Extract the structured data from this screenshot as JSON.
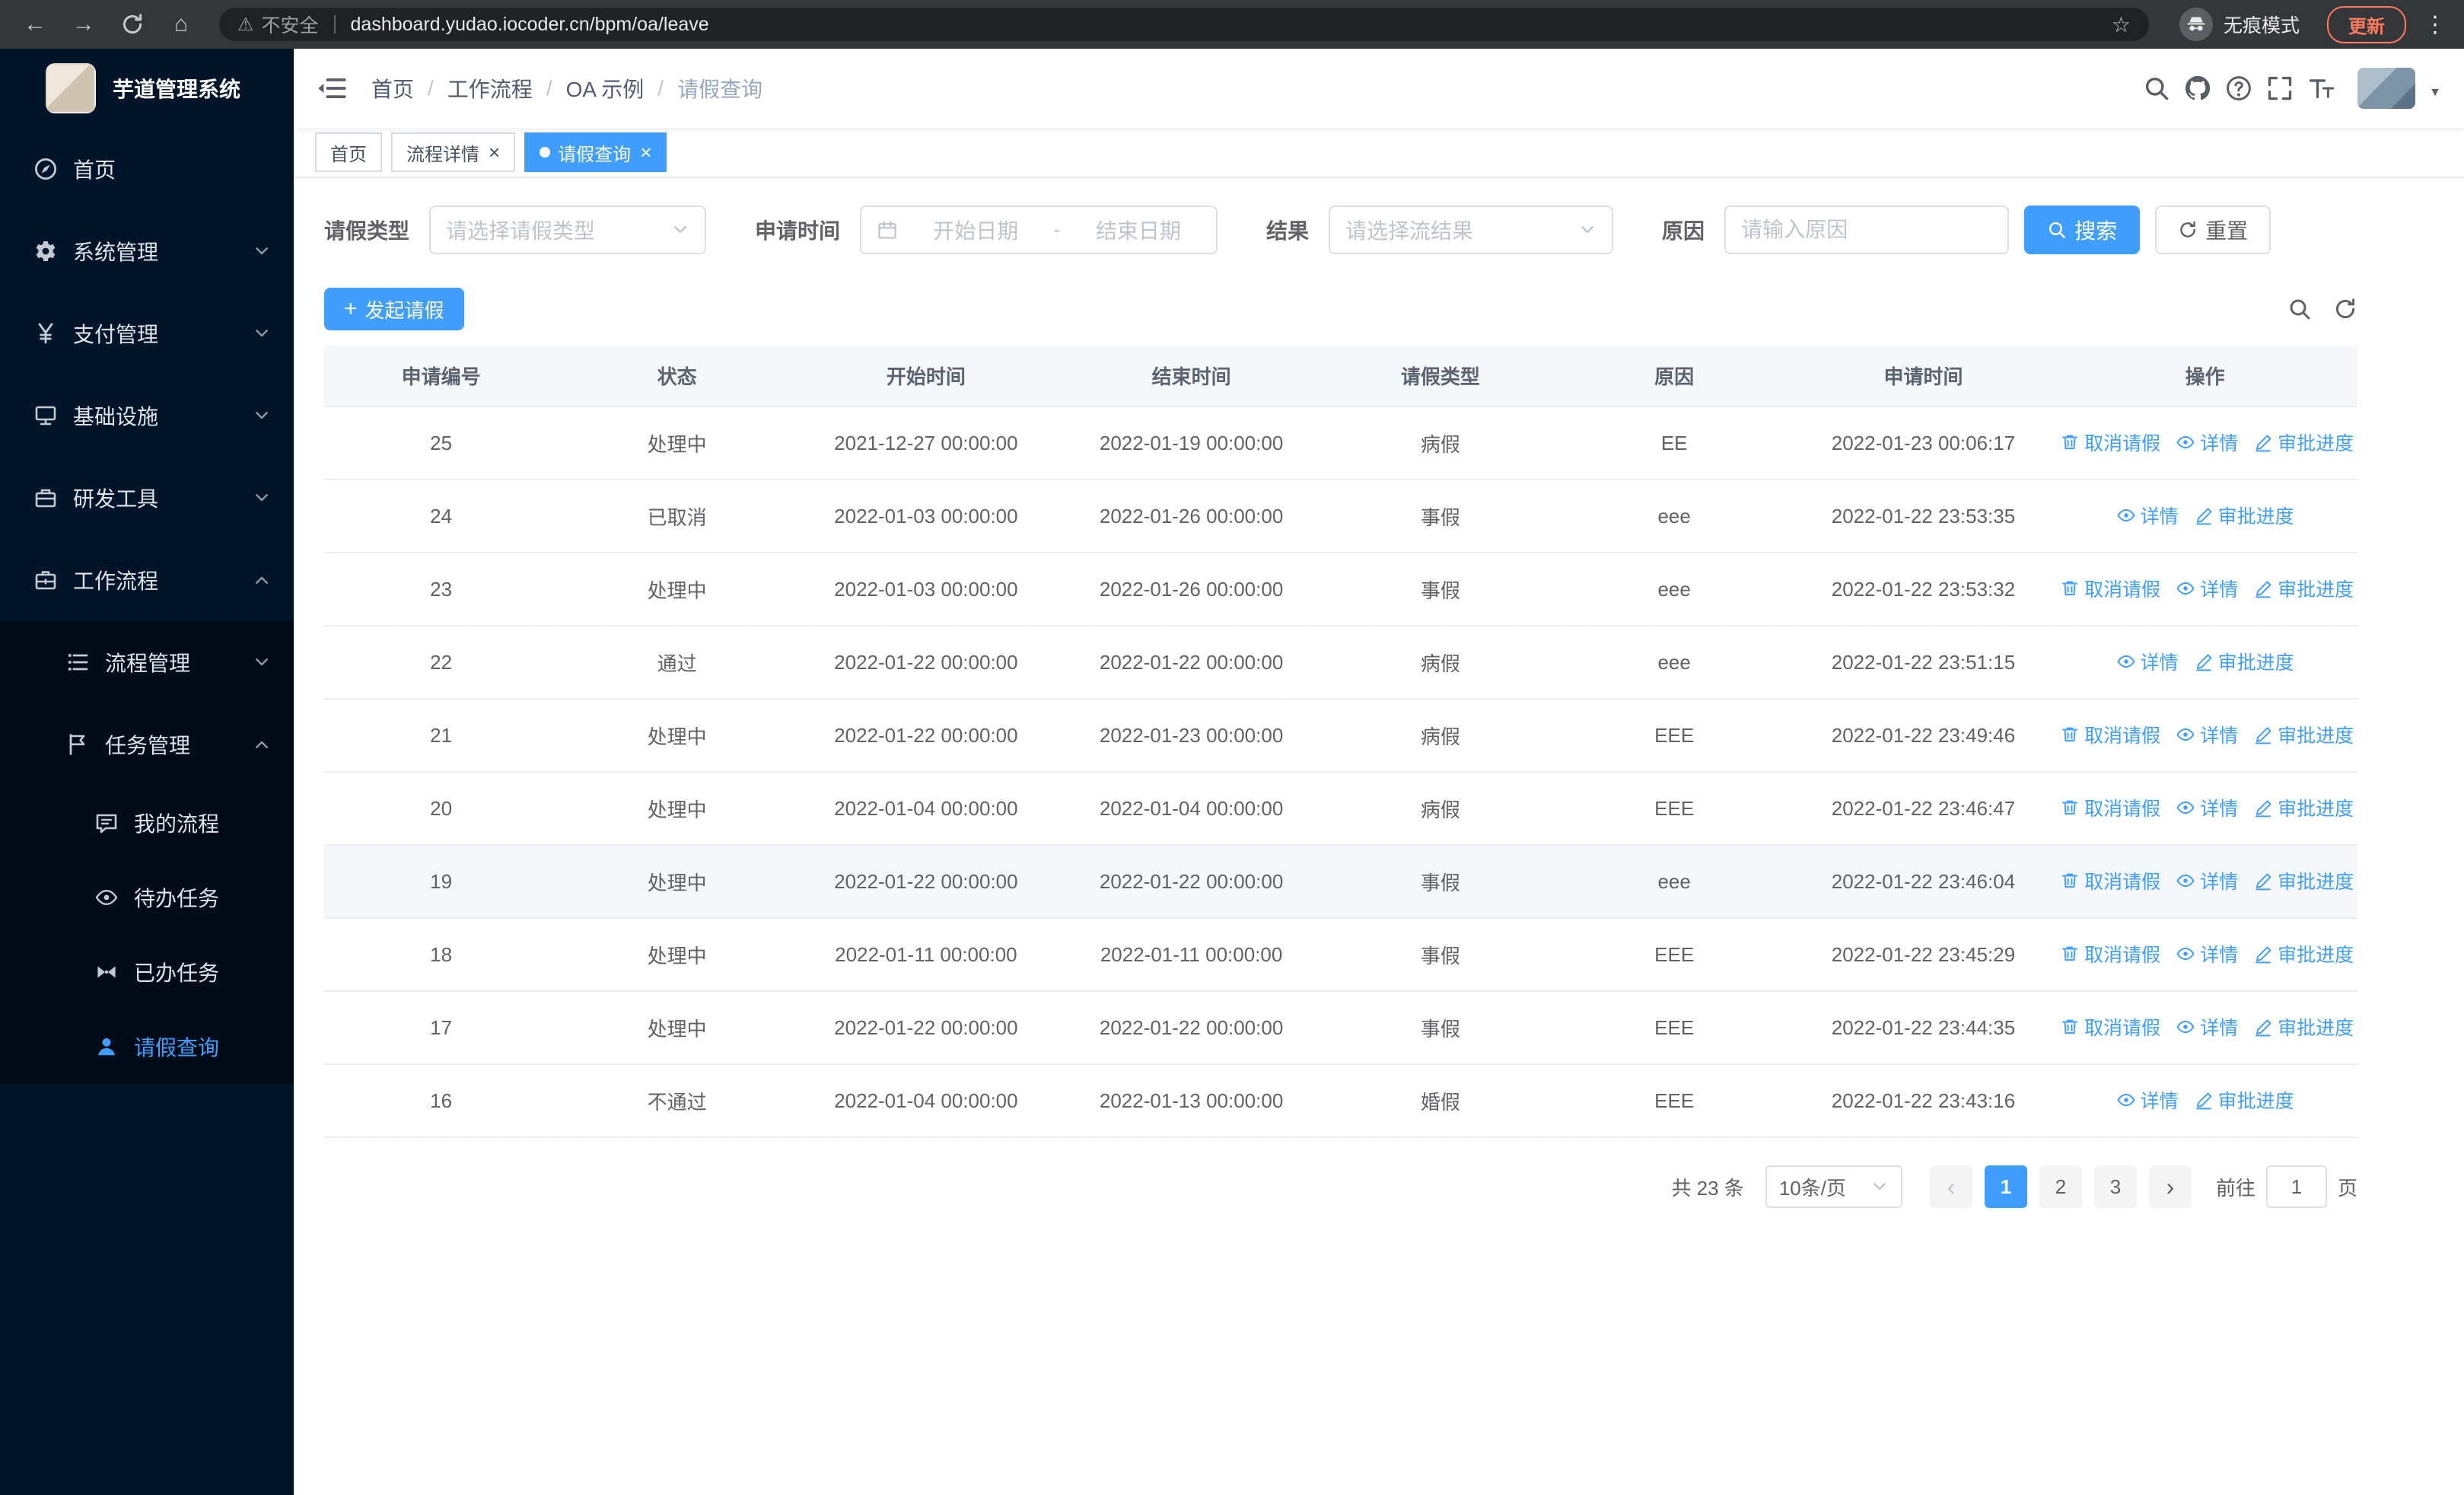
{
  "colors": {
    "primary": "#409eff",
    "link": "#409eff",
    "sidebar_bg": "#001529",
    "sidebar_sub_bg": "#000c17",
    "update_chip": "#ff7b5c"
  },
  "browser": {
    "security_warning": "不安全",
    "url": "dashboard.yudao.iocoder.cn/bpm/oa/leave",
    "incognito_label": "无痕模式",
    "update_button": "更新"
  },
  "sidebar": {
    "logo_title": "芋道管理系统",
    "menu": [
      {
        "id": "home",
        "label": "首页",
        "icon": "dashboard-icon",
        "level": 1
      },
      {
        "id": "system",
        "label": "系统管理",
        "icon": "gear-icon",
        "level": 1,
        "expandable": true
      },
      {
        "id": "payment",
        "label": "支付管理",
        "icon": "yen-icon",
        "level": 1,
        "expandable": true
      },
      {
        "id": "infrastructure",
        "label": "基础设施",
        "icon": "infrastructure-icon",
        "level": 1,
        "expandable": true
      },
      {
        "id": "devtools",
        "label": "研发工具",
        "icon": "toolbox-icon",
        "level": 1,
        "expandable": true
      },
      {
        "id": "workflow",
        "label": "工作流程",
        "icon": "briefcase-icon",
        "level": 1,
        "expandable": true,
        "expanded": true
      },
      {
        "id": "process-mgmt",
        "label": "流程管理",
        "icon": "list-icon",
        "level": 2,
        "expandable": true
      },
      {
        "id": "task-mgmt",
        "label": "任务管理",
        "icon": "flag-icon",
        "level": 2,
        "expandable": true,
        "expanded": true
      },
      {
        "id": "my-process",
        "label": "我的流程",
        "icon": "chat-icon",
        "level": 3
      },
      {
        "id": "todo-tasks",
        "label": "待办任务",
        "icon": "eye-icon",
        "level": 3
      },
      {
        "id": "done-tasks",
        "label": "已办任务",
        "icon": "scissors-icon",
        "level": 3
      },
      {
        "id": "leave-query",
        "label": "请假查询",
        "icon": "user-icon",
        "level": 3,
        "active": true
      }
    ]
  },
  "header": {
    "breadcrumb": [
      "首页",
      "工作流程",
      "OA 示例",
      "请假查询"
    ]
  },
  "tabs": [
    {
      "id": "home",
      "label": "首页",
      "closable": false,
      "active": false
    },
    {
      "id": "process-detail",
      "label": "流程详情",
      "closable": true,
      "active": false
    },
    {
      "id": "leave-query",
      "label": "请假查询",
      "closable": true,
      "active": true
    }
  ],
  "filters": {
    "leave_type_label": "请假类型",
    "leave_type_placeholder": "请选择请假类型",
    "apply_time_label": "申请时间",
    "start_date_placeholder": "开始日期",
    "date_separator": "-",
    "end_date_placeholder": "结束日期",
    "result_label": "结果",
    "result_placeholder": "请选择流结果",
    "reason_label": "原因",
    "reason_placeholder": "请输入原因",
    "search_button": "搜索",
    "reset_button": "重置"
  },
  "toolbar": {
    "create_button": "发起请假"
  },
  "table": {
    "columns": [
      "申请编号",
      "状态",
      "开始时间",
      "结束时间",
      "请假类型",
      "原因",
      "申请时间",
      "操作"
    ],
    "rows": [
      {
        "id": "25",
        "status": "处理中",
        "start_time": "2021-12-27 00:00:00",
        "end_time": "2022-01-19 00:00:00",
        "leave_type": "病假",
        "reason": "EE",
        "apply_time": "2022-01-23 00:06:17",
        "actions": [
          {
            "type": "cancel",
            "label": "取消请假"
          },
          {
            "type": "detail",
            "label": "详情"
          },
          {
            "type": "progress",
            "label": "审批进度"
          }
        ]
      },
      {
        "id": "24",
        "status": "已取消",
        "start_time": "2022-01-03 00:00:00",
        "end_time": "2022-01-26 00:00:00",
        "leave_type": "事假",
        "reason": "eee",
        "apply_time": "2022-01-22 23:53:35",
        "actions": [
          {
            "type": "detail",
            "label": "详情"
          },
          {
            "type": "progress",
            "label": "审批进度"
          }
        ]
      },
      {
        "id": "23",
        "status": "处理中",
        "start_time": "2022-01-03 00:00:00",
        "end_time": "2022-01-26 00:00:00",
        "leave_type": "事假",
        "reason": "eee",
        "apply_time": "2022-01-22 23:53:32",
        "actions": [
          {
            "type": "cancel",
            "label": "取消请假"
          },
          {
            "type": "detail",
            "label": "详情"
          },
          {
            "type": "progress",
            "label": "审批进度"
          }
        ]
      },
      {
        "id": "22",
        "status": "通过",
        "start_time": "2022-01-22 00:00:00",
        "end_time": "2022-01-22 00:00:00",
        "leave_type": "病假",
        "reason": "eee",
        "apply_time": "2022-01-22 23:51:15",
        "actions": [
          {
            "type": "detail",
            "label": "详情"
          },
          {
            "type": "progress",
            "label": "审批进度"
          }
        ]
      },
      {
        "id": "21",
        "status": "处理中",
        "start_time": "2022-01-22 00:00:00",
        "end_time": "2022-01-23 00:00:00",
        "leave_type": "病假",
        "reason": "EEE",
        "apply_time": "2022-01-22 23:49:46",
        "actions": [
          {
            "type": "cancel",
            "label": "取消请假"
          },
          {
            "type": "detail",
            "label": "详情"
          },
          {
            "type": "progress",
            "label": "审批进度"
          }
        ]
      },
      {
        "id": "20",
        "status": "处理中",
        "start_time": "2022-01-04 00:00:00",
        "end_time": "2022-01-04 00:00:00",
        "leave_type": "病假",
        "reason": "EEE",
        "apply_time": "2022-01-22 23:46:47",
        "actions": [
          {
            "type": "cancel",
            "label": "取消请假"
          },
          {
            "type": "detail",
            "label": "详情"
          },
          {
            "type": "progress",
            "label": "审批进度"
          }
        ]
      },
      {
        "id": "19",
        "status": "处理中",
        "start_time": "2022-01-22 00:00:00",
        "end_time": "2022-01-22 00:00:00",
        "leave_type": "事假",
        "reason": "eee",
        "apply_time": "2022-01-22 23:46:04",
        "highlighted": true,
        "actions": [
          {
            "type": "cancel",
            "label": "取消请假"
          },
          {
            "type": "detail",
            "label": "详情"
          },
          {
            "type": "progress",
            "label": "审批进度"
          }
        ]
      },
      {
        "id": "18",
        "status": "处理中",
        "start_time": "2022-01-11 00:00:00",
        "end_time": "2022-01-11 00:00:00",
        "leave_type": "事假",
        "reason": "EEE",
        "apply_time": "2022-01-22 23:45:29",
        "actions": [
          {
            "type": "cancel",
            "label": "取消请假"
          },
          {
            "type": "detail",
            "label": "详情"
          },
          {
            "type": "progress",
            "label": "审批进度"
          }
        ]
      },
      {
        "id": "17",
        "status": "处理中",
        "start_time": "2022-01-22 00:00:00",
        "end_time": "2022-01-22 00:00:00",
        "leave_type": "事假",
        "reason": "EEE",
        "apply_time": "2022-01-22 23:44:35",
        "actions": [
          {
            "type": "cancel",
            "label": "取消请假"
          },
          {
            "type": "detail",
            "label": "详情"
          },
          {
            "type": "progress",
            "label": "审批进度"
          }
        ]
      },
      {
        "id": "16",
        "status": "不通过",
        "start_time": "2022-01-04 00:00:00",
        "end_time": "2022-01-13 00:00:00",
        "leave_type": "婚假",
        "reason": "EEE",
        "apply_time": "2022-01-22 23:43:16",
        "actions": [
          {
            "type": "detail",
            "label": "详情"
          },
          {
            "type": "progress",
            "label": "审批进度"
          }
        ]
      }
    ]
  },
  "pagination": {
    "total_text": "共 23 条",
    "page_size": "10条/页",
    "pages": [
      "1",
      "2",
      "3"
    ],
    "active_page": "1",
    "prev_arrow": "‹",
    "next_arrow": "›",
    "goto_label": "前往",
    "goto_value": "1",
    "goto_suffix": "页"
  }
}
